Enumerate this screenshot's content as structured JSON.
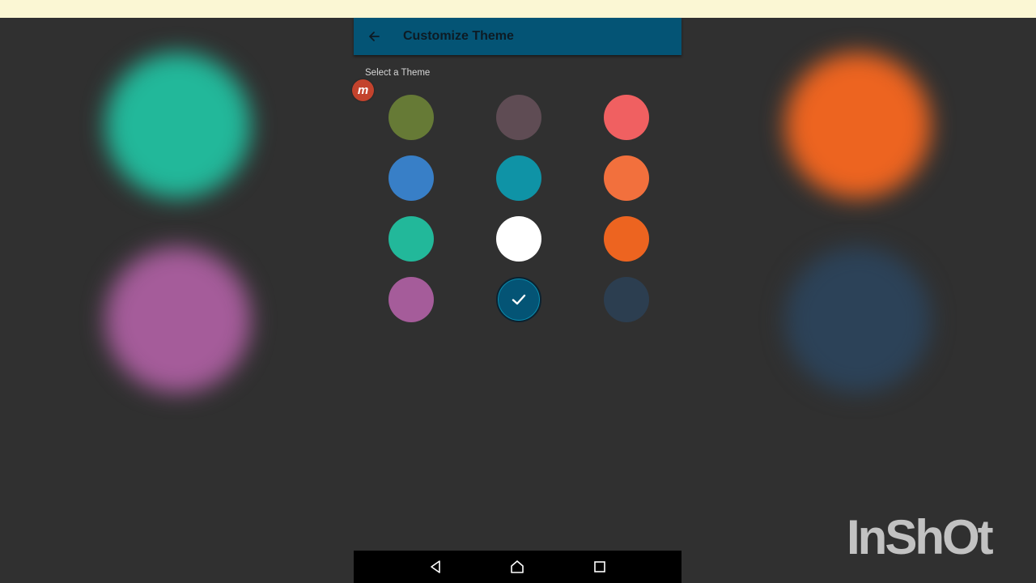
{
  "app": {
    "title": "Customize Theme",
    "section_label": "Select a Theme"
  },
  "overlay": {
    "recorder_badge": "m",
    "watermark": "InShOt"
  },
  "themes": [
    {
      "color": "#667a36",
      "selected": false
    },
    {
      "color": "#5f4c54",
      "selected": false
    },
    {
      "color": "#f06061",
      "selected": false
    },
    {
      "color": "#387fc7",
      "selected": false
    },
    {
      "color": "#0f93a6",
      "selected": false
    },
    {
      "color": "#f2703d",
      "selected": false
    },
    {
      "color": "#22b89a",
      "selected": false
    },
    {
      "color": "#ffffff",
      "selected": false
    },
    {
      "color": "#ed6420",
      "selected": false
    },
    {
      "color": "#a55c9a",
      "selected": false
    },
    {
      "color": "#045475",
      "selected": true
    },
    {
      "color": "#2c3e50",
      "selected": false
    }
  ],
  "background_blurs": [
    {
      "color": "#22b89a"
    },
    {
      "color": "#a55c9a"
    },
    {
      "color": "#ed6420"
    },
    {
      "color": "#2c4258"
    }
  ],
  "icons": {
    "back": "arrow-left-icon",
    "selected_check": "check-icon",
    "nav_back": "triangle-back-icon",
    "nav_home": "home-icon",
    "nav_recents": "square-recents-icon"
  }
}
